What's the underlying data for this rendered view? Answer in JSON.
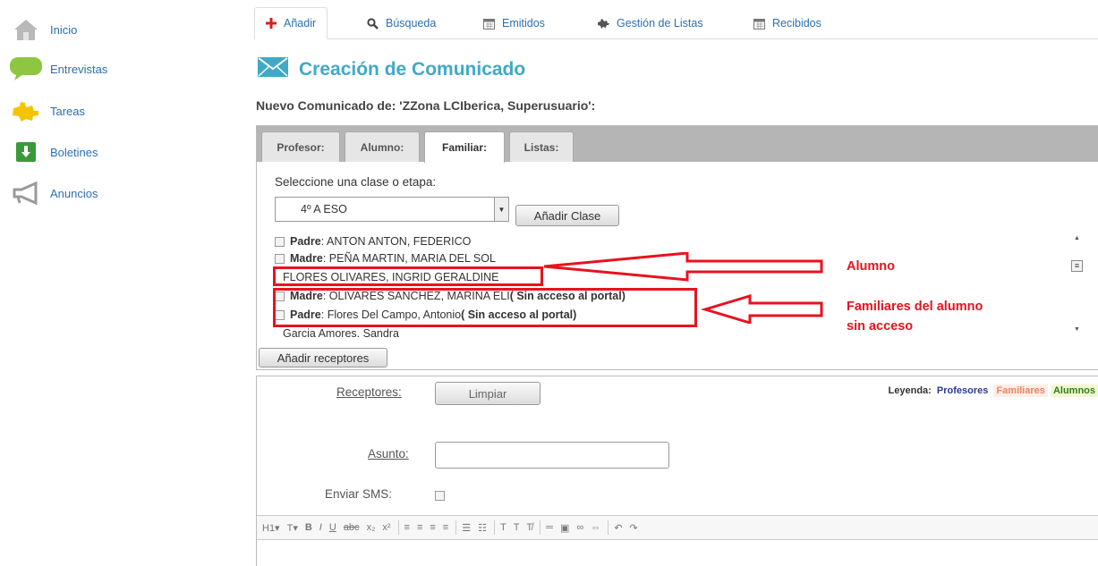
{
  "sidebar": {
    "items": [
      {
        "label": "Inicio",
        "icon": "home-icon"
      },
      {
        "label": "Entrevistas",
        "icon": "speech-bubble-icon"
      },
      {
        "label": "Tareas",
        "icon": "puzzle-icon"
      },
      {
        "label": "Boletines",
        "icon": "download-icon"
      },
      {
        "label": "Anuncios",
        "icon": "megaphone-icon"
      }
    ]
  },
  "nav": {
    "tabs": [
      {
        "label": "Añadir",
        "icon": "plus-icon",
        "active": true
      },
      {
        "label": "Búsqueda",
        "icon": "search-icon"
      },
      {
        "label": "Emitidos",
        "icon": "calendar-icon"
      },
      {
        "label": "Gestión de Listas",
        "icon": "puzzle-icon"
      },
      {
        "label": "Recibidos",
        "icon": "calendar-icon"
      }
    ]
  },
  "page": {
    "title": "Creación de Comunicado",
    "subtitle": "Nuevo Comunicado de: 'ZZona LCIberica, Superusuario':"
  },
  "tabs": {
    "items": [
      {
        "label": "Profesor:"
      },
      {
        "label": "Alumno:"
      },
      {
        "label": "Familiar:",
        "active": true
      },
      {
        "label": "Listas:"
      }
    ]
  },
  "selector": {
    "label": "Seleccione una clase o etapa:",
    "selected": "4º A ESO",
    "add_class_button": "Añadir Clase"
  },
  "recipients": {
    "rows": [
      {
        "role": "Padre",
        "name": ": ANTON ANTON, FEDERICO",
        "checkbox": true
      },
      {
        "role": "Madre",
        "name": ": PEÑA MARTIN, MARIA DEL SOL",
        "checkbox": true
      },
      {
        "role": "",
        "name": "FLORES OLIVARES, INGRID GERALDINE",
        "checkbox": false
      },
      {
        "role": "Madre",
        "name": ": OLIVARES SANCHEZ, MARINA ELI ",
        "note": "( Sin acceso al portal)",
        "checkbox": true
      },
      {
        "role": "Padre",
        "name": ": Flores Del Campo, Antonio ",
        "note": "( Sin acceso al portal)",
        "checkbox": true
      },
      {
        "role": "",
        "name": "Garcia Amores, Sandra",
        "checkbox": false
      }
    ],
    "add_button": "Añadir receptores"
  },
  "annotations": {
    "alumno": "Alumno",
    "familiares_line1": "Familiares del alumno",
    "familiares_line2": "sin acceso",
    "color": "#e8121e"
  },
  "form": {
    "receptores_label": "Receptores:",
    "clear_button": "Limpiar",
    "legend_label": "Leyenda:",
    "legend_items": [
      {
        "label": "Profesores",
        "color": "#2b3a8f",
        "bg": "#ffffff"
      },
      {
        "label": "Familiares",
        "color": "#f08060",
        "bg": "#fdeee8"
      },
      {
        "label": "Alumnos",
        "color": "#2e7d1a",
        "bg": "#f3f7d0"
      }
    ],
    "asunto_label": "Asunto:",
    "asunto_value": "",
    "sms_label": "Enviar SMS:"
  },
  "colors": {
    "accent": "#40a9c7",
    "link": "#2a6fb5",
    "nav_plus": "#d9201b"
  }
}
